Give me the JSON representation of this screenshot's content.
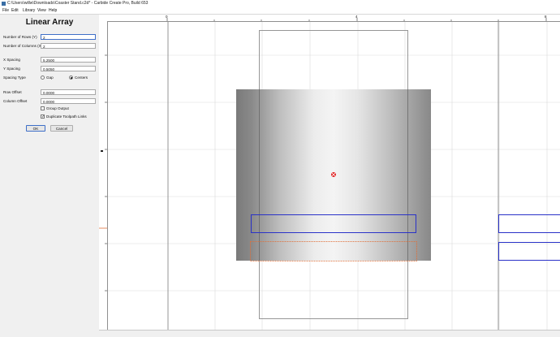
{
  "window": {
    "title": "C:\\Users\\willw\\Downloads\\Coaster Stand.c2d* - Carbide Create Pro, Build 653"
  },
  "menu": [
    "File",
    "Edit",
    "Library",
    "View",
    "Help"
  ],
  "panel": {
    "title": "Linear Array",
    "rows_label": "Number of Rows (Y)",
    "rows_value": "2",
    "cols_label": "Number of Columns (X)",
    "cols_value": "2",
    "x_spacing_label": "X Spacing",
    "x_spacing_value": "5.2500",
    "y_spacing_label": "Y Spacing",
    "y_spacing_value": "0.5050",
    "spacing_type_label": "Spacing Type",
    "spacing_gap_label": "Gap",
    "spacing_centers_label": "Centers",
    "spacing_selected": "Centers",
    "row_offset_label": "Row Offset",
    "row_offset_value": "0.0000",
    "col_offset_label": "Column Offset",
    "col_offset_value": "0.0000",
    "group_output_label": "Group Output",
    "group_output_checked": false,
    "dup_toolpath_label": "Duplicate Toolpath Links",
    "dup_toolpath_checked": true,
    "ok_label": "OK",
    "cancel_label": "Cancel"
  },
  "ruler": {
    "x_labels": [
      "0",
      "4",
      "8"
    ]
  },
  "colors": {
    "selection_outline": "#2a32c8",
    "toolpath_outline": "#e0703a",
    "origin_marker": "#e02020",
    "stock_outline": "#8c8c8c"
  }
}
